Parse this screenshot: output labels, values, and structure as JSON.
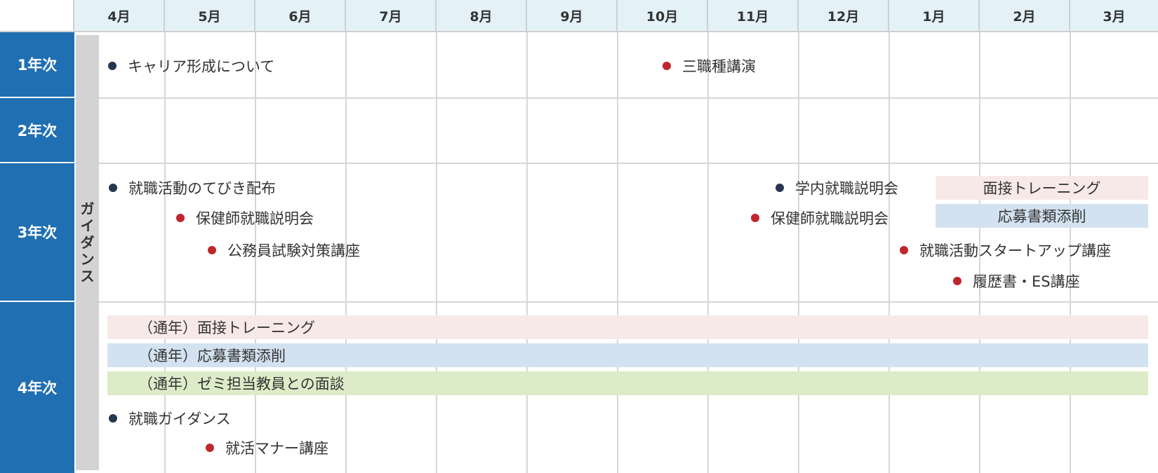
{
  "months": [
    "4月",
    "5月",
    "6月",
    "7月",
    "8月",
    "9月",
    "10月",
    "11月",
    "12月",
    "1月",
    "2月",
    "3月"
  ],
  "years": {
    "y1": "1年次",
    "y2": "2年次",
    "y3": "3年次",
    "y4": "4年次"
  },
  "guidance": [
    "ガ",
    "イ",
    "ダ",
    "ン",
    "ス"
  ],
  "events": {
    "y1_career": "キャリア形成について",
    "y1_three": "三職種講演",
    "y3_tebiki": "就職活動のてびき配布",
    "y3_hoken_may": "保健師就職説明会",
    "y3_koumuin": "公務員試験対策講座",
    "y3_gakunai": "学内就職説明会",
    "y3_hoken_nov": "保健師就職説明会",
    "y3_startup": "就職活動スタートアップ講座",
    "y3_rireki": "履歴書・ES講座",
    "y4_guidance": "就職ガイダンス",
    "y4_manner": "就活マナー講座"
  },
  "bands": {
    "y3_interview": "面接トレーニング",
    "y3_application": "応募書類添削",
    "y4_interview": "（通年）面接トレーニング",
    "y4_application": "（通年）応募書類添削",
    "y4_seminar": "（通年）ゼミ担当教員との面談"
  },
  "colors": {
    "year_header": "#1f6fb2",
    "month_header": "#e4f2f7",
    "dot_dark": "#26364f",
    "dot_red": "#c0262d",
    "band_pink": "#f8e9e9",
    "band_blue": "#d3e2f0",
    "band_green": "#dcecc8",
    "guidance": "#d3d3d3"
  }
}
